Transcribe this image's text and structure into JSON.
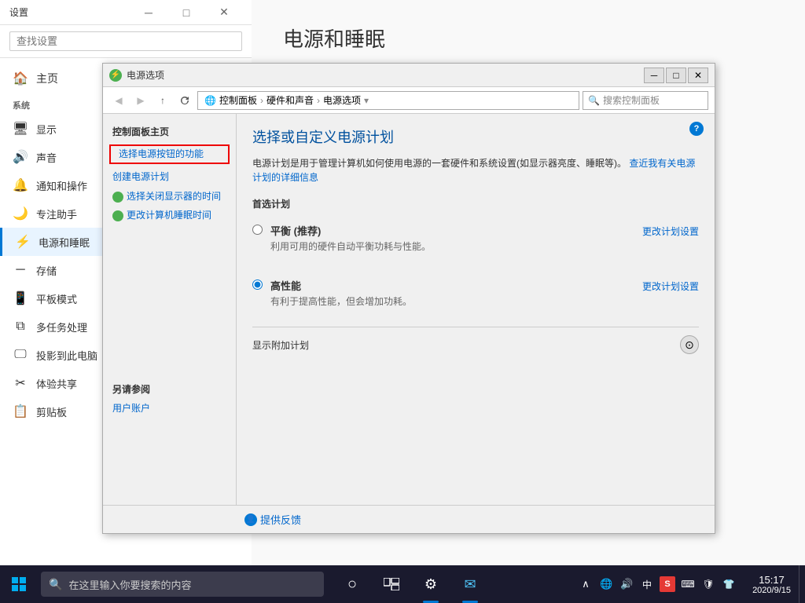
{
  "settings": {
    "title": "设置",
    "search_placeholder": "查找设置",
    "home_label": "主页",
    "section_system": "系统",
    "nav_items": [
      {
        "id": "display",
        "icon": "🖥",
        "label": "显示"
      },
      {
        "id": "sound",
        "icon": "🔊",
        "label": "声音"
      },
      {
        "id": "notifications",
        "icon": "🔔",
        "label": "通知和操作"
      },
      {
        "id": "focus",
        "icon": "🌙",
        "label": "专注助手"
      },
      {
        "id": "power",
        "icon": "⚡",
        "label": "电源和睡眠",
        "active": true
      },
      {
        "id": "storage",
        "icon": "💾",
        "label": "存储"
      },
      {
        "id": "tablet",
        "icon": "📱",
        "label": "平板模式"
      },
      {
        "id": "multitask",
        "icon": "⧉",
        "label": "多任务处理"
      },
      {
        "id": "project",
        "icon": "🖵",
        "label": "投影到此电脑"
      },
      {
        "id": "shared",
        "icon": "✂",
        "label": "体验共享"
      },
      {
        "id": "clipboard",
        "icon": "📋",
        "label": "剪贴板"
      }
    ],
    "main_title": "电源和睡眠"
  },
  "power_dialog": {
    "title": "电源选项",
    "min_btn": "─",
    "max_btn": "□",
    "close_btn": "✕",
    "back_disabled": true,
    "forward_disabled": true,
    "up_label": "↑",
    "addr_globe": "🌐",
    "addr_parts": [
      "控制面板",
      "硬件和声音",
      "电源选项"
    ],
    "addr_sep": "›",
    "search_placeholder": "搜索控制面板",
    "sidebar_title": "控制面板主页",
    "sidebar_links": [
      {
        "label": "选择电源按钮的功能",
        "highlighted": true
      },
      {
        "label": "创建电源计划"
      },
      {
        "label": "选择关闭显示器的时间",
        "icon": true
      },
      {
        "label": "更改计算机睡眠时间",
        "icon": true
      }
    ],
    "content_title": "选择或自定义电源计划",
    "content_desc": "电源计划是用于管理计算机如何使用电源的一套硬件和系统设置(如显示器亮度、睡眠等)。",
    "content_link": "查近我有关电源计划的详细信息",
    "preferred_title": "首选计划",
    "plans": [
      {
        "name": "平衡 (推荐)",
        "desc": "利用可用的硬件自动平衡功耗与性能。",
        "change_label": "更改计划设置",
        "selected": false
      },
      {
        "name": "高性能",
        "desc": "有利于提高性能，但会增加功耗。",
        "change_label": "更改计划设置",
        "selected": true
      }
    ],
    "additional_label": "显示附加计划",
    "help_label": "?",
    "also_see_title": "另请参阅",
    "also_see_links": [
      "用户账户"
    ],
    "feedback_label": "提供反馈"
  },
  "taskbar": {
    "search_placeholder": "在这里输入你要搜索的内容",
    "time": "15:17",
    "date": "2020/9/15",
    "apps": [
      {
        "icon": "○",
        "name": "search"
      },
      {
        "icon": "⊞",
        "name": "task-view"
      },
      {
        "icon": "⚙",
        "name": "settings"
      },
      {
        "icon": "✉",
        "name": "mail"
      }
    ],
    "systray": {
      "chevron": "∧",
      "network": "🌐",
      "sound": "🔊",
      "ime": "中",
      "sogou": "S",
      "keyboard": "⌨",
      "shield": "🛡",
      "shirt": "👕"
    }
  }
}
